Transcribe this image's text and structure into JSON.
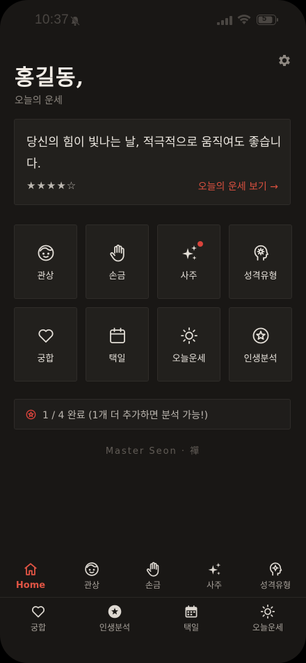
{
  "status_bar": {
    "time": "10:37",
    "battery": "5"
  },
  "header": {
    "greeting": "홍길동,",
    "subtitle": "오늘의 운세"
  },
  "fortune": {
    "message": "당신의 힘이 빛나는 날, 적극적으로 움직여도 좋습니다.",
    "stars": "★★★★☆",
    "rating": 4,
    "link_label": "오늘의 운세 보기 →"
  },
  "grid": {
    "tiles": [
      {
        "label": "관상",
        "icon": "face-icon"
      },
      {
        "label": "손금",
        "icon": "hand-icon"
      },
      {
        "label": "사주",
        "icon": "sparkles-icon"
      },
      {
        "label": "성격유형",
        "icon": "brain-icon"
      },
      {
        "label": "궁합",
        "icon": "heart-icon"
      },
      {
        "label": "택일",
        "icon": "calendar-icon"
      },
      {
        "label": "오늘운세",
        "icon": "sun-icon"
      },
      {
        "label": "인생분석",
        "icon": "star-circle-icon"
      }
    ]
  },
  "progress": {
    "text": "1 / 4 완료 (1개 더 추가하면 분석 가능!)",
    "completed": 1,
    "total": 4
  },
  "brand": "Master Seon · 禪",
  "nav": {
    "row1": [
      {
        "label": "Home",
        "icon": "home-icon"
      },
      {
        "label": "관상",
        "icon": "face-icon"
      },
      {
        "label": "손금",
        "icon": "hand-icon"
      },
      {
        "label": "사주",
        "icon": "sparkles-icon"
      },
      {
        "label": "성격유형",
        "icon": "brain-icon"
      }
    ],
    "row2": [
      {
        "label": "궁합",
        "icon": "heart-icon"
      },
      {
        "label": "인생분석",
        "icon": "star-circle-icon"
      },
      {
        "label": "택일",
        "icon": "calendar-icon"
      },
      {
        "label": "오늘운세",
        "icon": "sun-icon"
      }
    ]
  },
  "colors": {
    "accent": "#d9503f",
    "background": "#191715",
    "card": "#22201d"
  }
}
